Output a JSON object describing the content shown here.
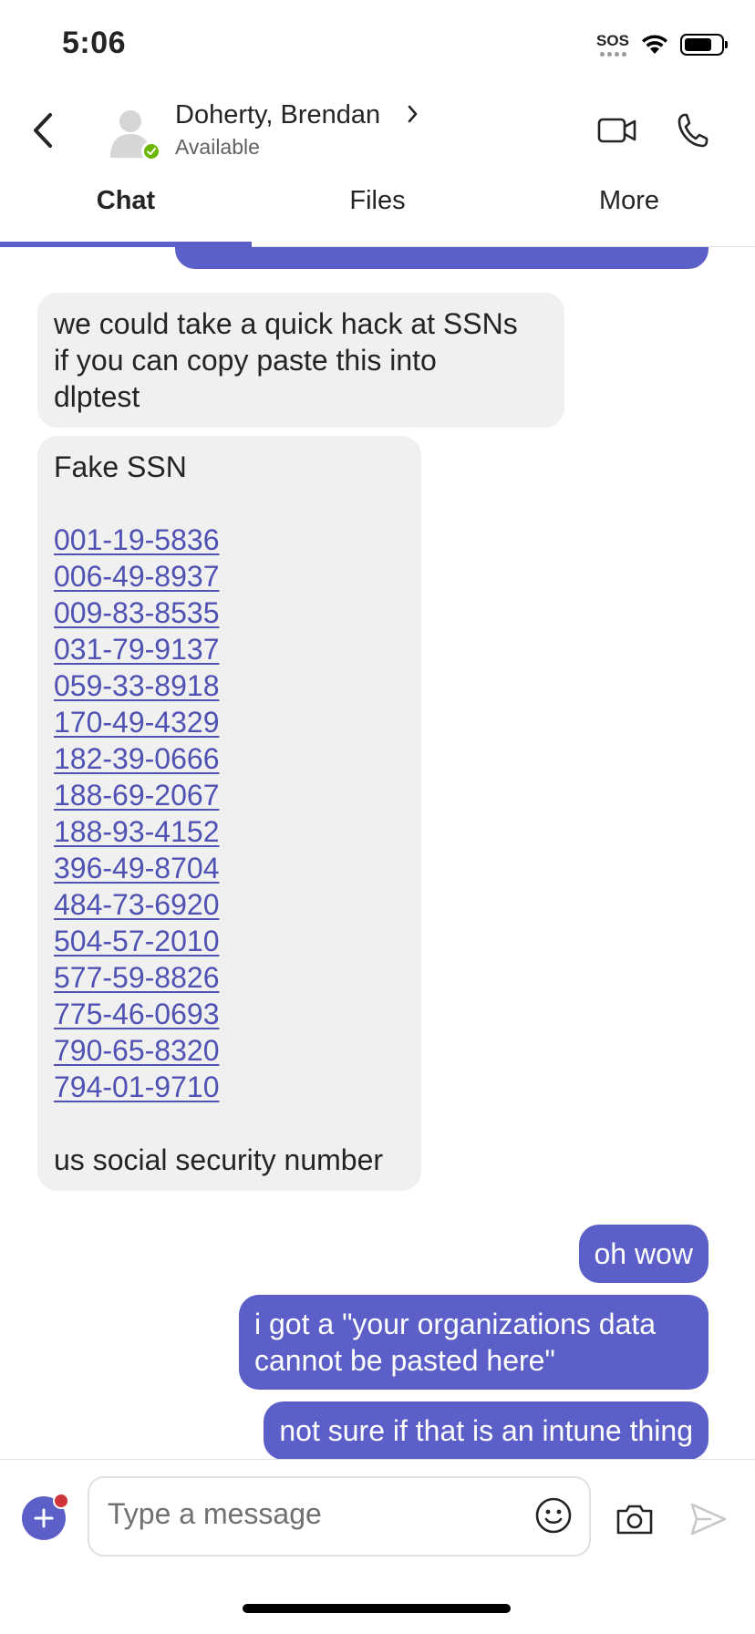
{
  "status_bar": {
    "time": "5:06",
    "sos_label": "SOS",
    "battery_level": 0.76
  },
  "header": {
    "contact_name": "Doherty, Brendan",
    "contact_status": "Available",
    "presence": "available",
    "icons": {
      "back": "chevron-left-icon",
      "video": "video-camera-icon",
      "call": "phone-icon",
      "chevron": "chevron-right-icon"
    }
  },
  "tabs": [
    {
      "label": "Chat",
      "active": true
    },
    {
      "label": "Files",
      "active": false
    },
    {
      "label": "More",
      "active": false
    }
  ],
  "messages": {
    "m1_lines": [
      "we could take a quick hack at SSNs",
      "if you can copy paste this into",
      "dlptest"
    ],
    "m2_title": "Fake SSN",
    "m2_ssns": [
      "001-19-5836",
      "006-49-8937",
      "009-83-8535",
      "031-79-9137",
      "059-33-8918",
      "170-49-4329",
      "182-39-0666",
      "188-69-2067",
      "188-93-4152",
      "396-49-8704",
      "484-73-6920",
      "504-57-2010",
      "577-59-8826",
      "775-46-0693",
      "790-65-8320",
      "794-01-9710"
    ],
    "m2_footer": "us social security number",
    "m3": "oh wow",
    "m4_lines": [
      "i got a \"your organizations data",
      "cannot be pasted here\""
    ],
    "m5": "not sure if that is an intune thing"
  },
  "composer": {
    "placeholder": "Type a message",
    "has_notification": true,
    "icons": {
      "add": "plus-icon",
      "emoji": "emoji-icon",
      "camera": "camera-icon",
      "send": "send-icon"
    }
  },
  "colors": {
    "accent": "#5b5fc7",
    "link": "#4f52b2",
    "incoming_bubble": "#f0f0f0",
    "presence_green": "#6bb700",
    "badge_red": "#d13438"
  }
}
